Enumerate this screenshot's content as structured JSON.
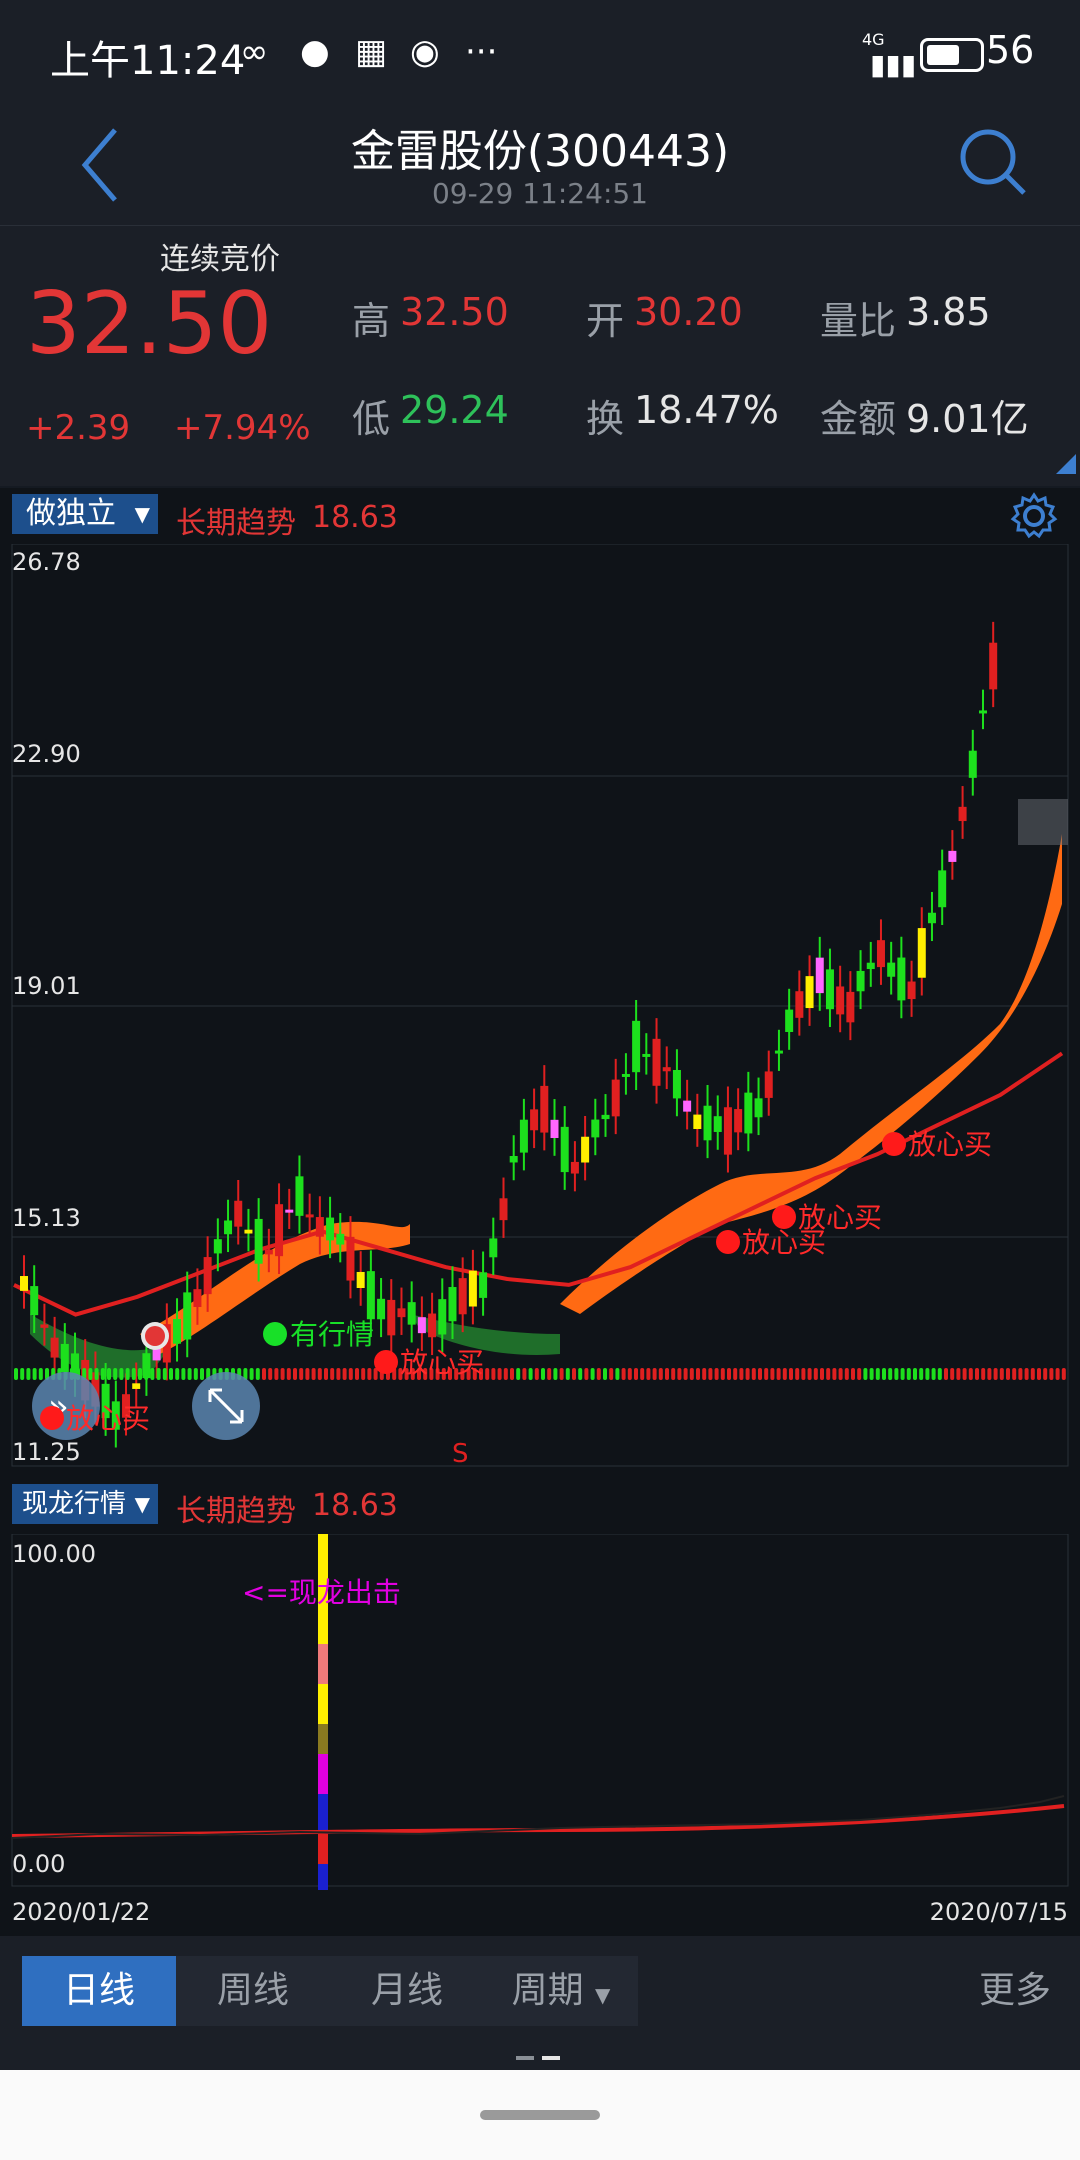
{
  "status": {
    "time": "上午11:24",
    "network": "4G",
    "battery": "56"
  },
  "header": {
    "title": "金雷股份(300443)",
    "timestamp": "09-29 11:24:51"
  },
  "quote": {
    "state": "连续竞价",
    "price": "32.50",
    "change": "+2.39",
    "change_pct": "+7.94%",
    "high_label": "高",
    "high": "32.50",
    "low_label": "低",
    "low": "29.24",
    "open_label": "开",
    "open": "30.20",
    "turnover_label": "换",
    "turnover": "18.47%",
    "vol_ratio_label": "量比",
    "vol_ratio": "3.85",
    "amount_label": "金额",
    "amount": "9.01亿"
  },
  "main_chart": {
    "indicator": "做独立",
    "trend_label": "长期趋势",
    "trend_value": "18.63",
    "y_ticks": [
      "26.78",
      "22.90",
      "19.01",
      "15.13",
      "11.25"
    ],
    "signals": [
      "放心买",
      "有行情",
      "放心买",
      "放心买",
      "放心买",
      "放心买"
    ],
    "marker_s": "S"
  },
  "sub_chart": {
    "indicator": "现龙行情",
    "trend_label": "长期趋势",
    "trend_value": "18.63",
    "y_top": "100.00",
    "y_bottom": "0.00",
    "annotation": "<=现龙出击",
    "date_start": "2020/01/22",
    "date_end": "2020/07/15"
  },
  "chart_data": {
    "type": "line",
    "title": "",
    "xlabel": "",
    "ylabel": "",
    "x": [
      "2020/01/22",
      "2020/07/15"
    ],
    "ylim": [
      11.25,
      26.78
    ],
    "series": [
      {
        "name": "长期趋势",
        "values": [
          14.3,
          13.8,
          14.1,
          14.5,
          14.9,
          15.2,
          14.9,
          14.6,
          14.4,
          14.3,
          14.6,
          15.1,
          15.6,
          16.1,
          16.5,
          17.0,
          17.5,
          18.2
        ]
      }
    ]
  },
  "tabs": {
    "day": "日线",
    "week": "周线",
    "month": "月线",
    "period": "周期",
    "more": "更多"
  },
  "colors": {
    "up": "#e23636",
    "down": "#2ec15a",
    "accent": "#2f6fc0"
  }
}
